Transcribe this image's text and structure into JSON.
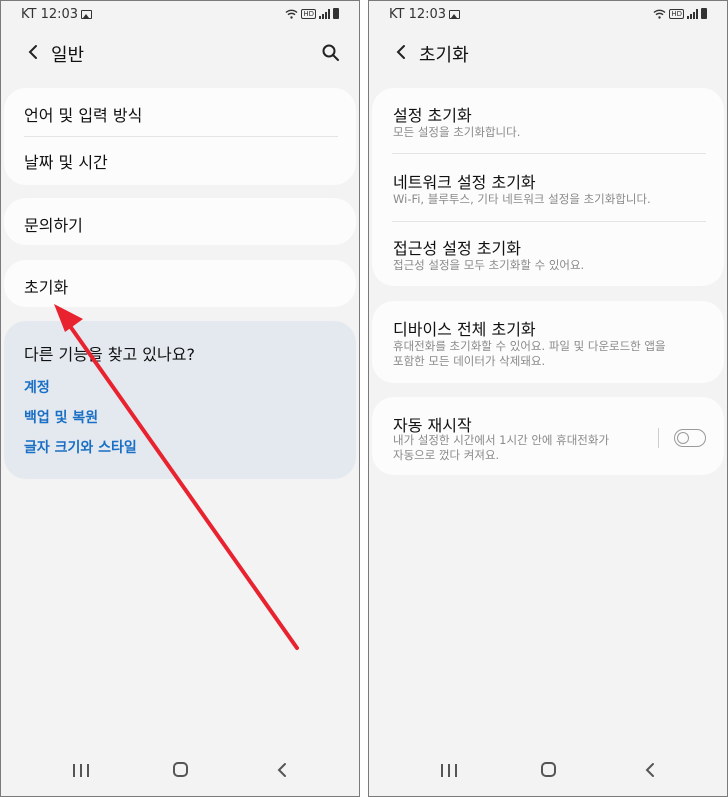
{
  "status": {
    "carrier_time": "KT 12:03"
  },
  "left_screen": {
    "title": "일반",
    "group1": [
      "언어 및 입력 방식",
      "날짜 및 시간"
    ],
    "contact": "문의하기",
    "reset": "초기화",
    "suggest": {
      "heading": "다른 기능을 찾고 있나요?",
      "links": [
        "계정",
        "백업 및 복원",
        "글자 크기와 스타일"
      ]
    }
  },
  "right_screen": {
    "title": "초기화",
    "items": [
      {
        "title": "설정 초기화",
        "subtitle": "모든 설정을 초기화합니다."
      },
      {
        "title": "네트워크 설정 초기화",
        "subtitle": "Wi-Fi, 블루투스, 기타 네트워크 설정을 초기화합니다."
      },
      {
        "title": "접근성 설정 초기화",
        "subtitle": "접근성 설정을 모두 초기화할 수 있어요."
      }
    ],
    "factory": {
      "title": "디바이스 전체 초기화",
      "subtitle1": "휴대전화를 초기화할 수 있어요. 파일 및 다운로드한 앱을",
      "subtitle2": "포함한 모든 데이터가 삭제돼요."
    },
    "auto_restart": {
      "title": "자동 재시작",
      "subtitle1": "내가 설정한 시간에서 1시간 안에 휴대전화가",
      "subtitle2": "자동으로 껐다 켜져요.",
      "enabled": false
    }
  },
  "colors": {
    "link": "#1a6fc4",
    "annotation_arrow": "#e8222e",
    "suggest_bg": "#e3e9ef"
  }
}
